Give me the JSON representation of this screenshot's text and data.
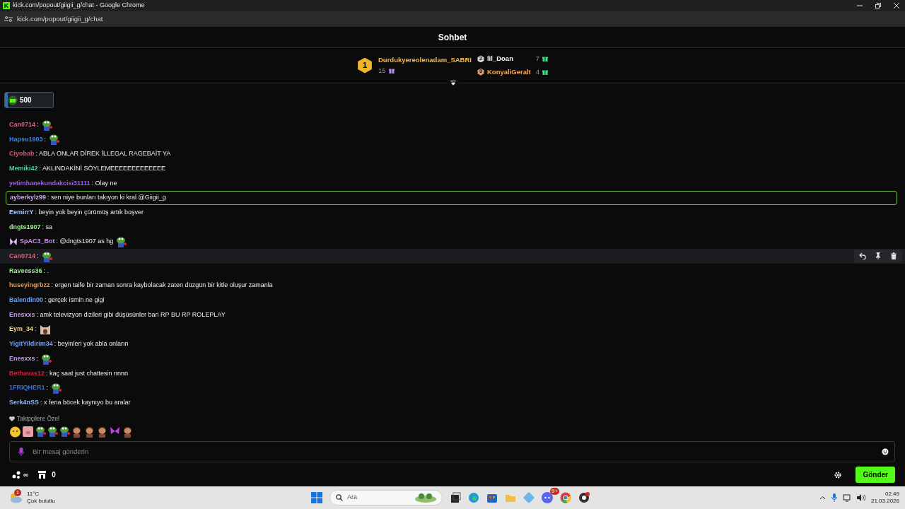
{
  "window": {
    "title": "kick.com/popout/giigii_g/chat - Google Chrome",
    "logo_letter": "K"
  },
  "address_bar": {
    "url": "kick.com/popout/giigii_g/chat"
  },
  "header": {
    "title": "Sohbet"
  },
  "leaderboard": [
    {
      "rank": "1",
      "name": "Durdukyereolenadam_SABRI",
      "color": "#f5b942",
      "gift": {
        "count": "15",
        "color": "#b98cf0"
      }
    },
    {
      "rank": "2",
      "name": "lil_Doan",
      "color": "#ffffff",
      "gift": {
        "count": "7",
        "color": "#3fe08a"
      }
    },
    {
      "rank": "3",
      "name": "KonyaliGeralt",
      "color": "#f5a962",
      "gift": {
        "count": "4",
        "color": "#3fe08a"
      }
    }
  ],
  "points": {
    "value": "500"
  },
  "messages": [
    {
      "user": "Can0714",
      "color": "#e0607e",
      "text": ":",
      "emotes": [
        {
          "kind": "frog"
        }
      ],
      "highlighted": false,
      "hovered": false
    },
    {
      "user": "Hapsu1903",
      "color": "#3b82f6",
      "text": ":",
      "emotes": [
        {
          "kind": "frog"
        }
      ],
      "highlighted": false,
      "hovered": false
    },
    {
      "user": "Ciyobab",
      "color": "#e0506e",
      "text": ": ABLA ONLAR DİREK İLLEGAL RAGEBAİT YA",
      "highlighted": false,
      "hovered": false
    },
    {
      "user": "Memiki42",
      "color": "#4fd1a5",
      "text": ": AKLINDAKİNİ SÖYLEMEEEEEEEEEEEEE",
      "highlighted": false,
      "hovered": false
    },
    {
      "user": "yetimhanekundakcisi31111",
      "color": "#a657ee",
      "text": ": Olay ne",
      "highlighted": false,
      "hovered": false
    },
    {
      "user": "ayberkylz99",
      "color": "#c9a3f7",
      "text": ": sen niye bunları takıyon ki kral @Giigii_g",
      "highlighted": true,
      "hovered": false
    },
    {
      "user": "EemirrY",
      "color": "#a8c8ff",
      "text": ": beyin yok beyin çürümüş artık boşver",
      "highlighted": false,
      "hovered": false
    },
    {
      "user": "dngts1907",
      "color": "#9cf58a",
      "text": ": sa",
      "highlighted": false,
      "hovered": false
    },
    {
      "user": "SpAC3_Bot",
      "color": "#d28cf5",
      "badge": {
        "kind": "butterfly"
      },
      "text": ": @dngts1907 as hg",
      "emotes": [
        {
          "kind": "frog"
        }
      ],
      "highlighted": false,
      "hovered": false
    },
    {
      "user": "Can0714",
      "color": "#e0607e",
      "text": ":",
      "emotes": [
        {
          "kind": "frog"
        }
      ],
      "highlighted": false,
      "hovered": true
    },
    {
      "user": "Raveess36",
      "color": "#9cf58a",
      "text": ": .",
      "highlighted": false,
      "hovered": false
    },
    {
      "user": "huseyingrbzz",
      "color": "#f0923a",
      "text": ": ergen taife bir zaman sonra kaybolacak zaten düzgün bir kitle oluşur zamanla",
      "highlighted": false,
      "hovered": false
    },
    {
      "user": "Balendin00",
      "color": "#6ea0f5",
      "text": ": gerçek ismin ne gigi",
      "highlighted": false,
      "hovered": false
    },
    {
      "user": "Enesxxs",
      "color": "#c59af5",
      "text": ": amk televizyon dizileri gibi düşüsünler bari RP BU RP ROLEPLAY",
      "highlighted": false,
      "hovered": false
    },
    {
      "user": "Eym_34",
      "color": "#f5d08c",
      "text": ":",
      "emotes": [
        {
          "kind": "cat"
        }
      ],
      "highlighted": false,
      "hovered": false
    },
    {
      "user": "YigitYildirim34",
      "color": "#6ea0f5",
      "text": ": beyinleri yok abla onların",
      "highlighted": false,
      "hovered": false
    },
    {
      "user": "Enesxxs",
      "color": "#c59af5",
      "text": ":",
      "emotes": [
        {
          "kind": "frog"
        }
      ],
      "highlighted": false,
      "hovered": false
    },
    {
      "user": "Bethavas12",
      "color": "#d0233f",
      "text": ": kaç saat just chattesin nnnn",
      "highlighted": false,
      "hovered": false
    },
    {
      "user": "1FRIQHER1",
      "color": "#3b6fe0",
      "text": ":",
      "emotes": [
        {
          "kind": "frog"
        }
      ],
      "highlighted": false,
      "hovered": false
    },
    {
      "user": "Serk4nSS",
      "color": "#8fb5f5",
      "text": ": x fena böcek kaynıyo bu aralar",
      "highlighted": false,
      "hovered": false
    }
  ],
  "emote_bar": {
    "label": "Takipçilere Özel",
    "emotes": [
      {
        "kind": "blob"
      },
      {
        "kind": "pig"
      },
      {
        "kind": "frog"
      },
      {
        "kind": "frog"
      },
      {
        "kind": "frog"
      },
      {
        "kind": "face"
      },
      {
        "kind": "face"
      },
      {
        "kind": "face"
      },
      {
        "kind": "butterfly"
      },
      {
        "kind": "face"
      }
    ]
  },
  "composer": {
    "placeholder": "Bir mesaj gönderin",
    "send_label": "Gönder"
  },
  "footer": {
    "streak": "∞",
    "shop_count": "0"
  },
  "taskbar": {
    "temperature": "11°C",
    "weather": "Çok bulutlu",
    "weather_badge": "1",
    "search_placeholder": "Ara",
    "discord_badge": "9+",
    "time": "02:49",
    "date": "21.03.2026"
  }
}
